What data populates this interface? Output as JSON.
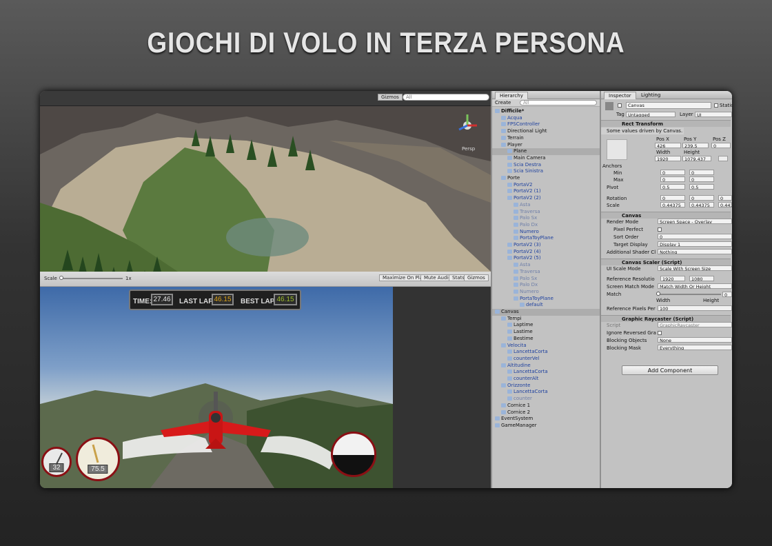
{
  "headline": "GIOCHI DI VOLO IN TERZA PERSONA",
  "scene_view": {
    "toolbar": {
      "gizmos_label": "Gizmos",
      "search_placeholder": "All"
    },
    "persp_label": "Persp"
  },
  "game_view": {
    "toolbar": {
      "scale_label": "Scale",
      "scale_value": "1x",
      "maximize_label": "Maximize On Play",
      "mute_label": "Mute Audio",
      "stats_label": "Stats",
      "gizmos_label": "Gizmos"
    },
    "hud": {
      "time_label": "TIME:",
      "time_value": "27.46",
      "last_lap_label": "LAST LAP:",
      "last_lap_value": "46.15",
      "best_lap_label": "BEST LAP:",
      "best_lap_value": "46.15"
    },
    "gauge_small_value": "32",
    "gauge_large_value": "75.5"
  },
  "hierarchy": {
    "tab_label": "Hierarchy",
    "create_label": "Create",
    "search_placeholder": "All",
    "items": [
      {
        "label": "Difficile*",
        "depth": 0,
        "style": "bold"
      },
      {
        "label": "Acqua",
        "depth": 1,
        "style": "blue"
      },
      {
        "label": "FPSController",
        "depth": 1,
        "style": "blue"
      },
      {
        "label": "Directional Light",
        "depth": 1,
        "style": "normal"
      },
      {
        "label": "Terrain",
        "depth": 1,
        "style": "normal"
      },
      {
        "label": "Player",
        "depth": 1,
        "style": "normal"
      },
      {
        "label": "Plane",
        "depth": 2,
        "style": "selected"
      },
      {
        "label": "Main Camera",
        "depth": 2,
        "style": "normal"
      },
      {
        "label": "Scia Destra",
        "depth": 2,
        "style": "blue"
      },
      {
        "label": "Scia Sinistra",
        "depth": 2,
        "style": "blue"
      },
      {
        "label": "Porte",
        "depth": 1,
        "style": "normal"
      },
      {
        "label": "PortaV2",
        "depth": 2,
        "style": "blue"
      },
      {
        "label": "PortaV2 (1)",
        "depth": 2,
        "style": "blue"
      },
      {
        "label": "PortaV2 (2)",
        "depth": 2,
        "style": "blue"
      },
      {
        "label": "Asta",
        "depth": 3,
        "style": "faded"
      },
      {
        "label": "Traversa",
        "depth": 3,
        "style": "faded"
      },
      {
        "label": "Palo Sx",
        "depth": 3,
        "style": "faded"
      },
      {
        "label": "Palo Dx",
        "depth": 3,
        "style": "faded"
      },
      {
        "label": "Numero",
        "depth": 3,
        "style": "blue"
      },
      {
        "label": "PortaToyPlane",
        "depth": 3,
        "style": "blue"
      },
      {
        "label": "PortaV2 (3)",
        "depth": 2,
        "style": "blue"
      },
      {
        "label": "PortaV2 (4)",
        "depth": 2,
        "style": "blue"
      },
      {
        "label": "PortaV2 (5)",
        "depth": 2,
        "style": "blue"
      },
      {
        "label": "Asta",
        "depth": 3,
        "style": "faded"
      },
      {
        "label": "Traversa",
        "depth": 3,
        "style": "faded"
      },
      {
        "label": "Palo Sx",
        "depth": 3,
        "style": "faded"
      },
      {
        "label": "Palo Dx",
        "depth": 3,
        "style": "faded"
      },
      {
        "label": "Numero",
        "depth": 3,
        "style": "faded"
      },
      {
        "label": "PortaToyPlane",
        "depth": 3,
        "style": "blue"
      },
      {
        "label": "default",
        "depth": 4,
        "style": "blue"
      },
      {
        "label": "Canvas",
        "depth": 0,
        "style": "selected"
      },
      {
        "label": "Tempi",
        "depth": 1,
        "style": "normal"
      },
      {
        "label": "Laptime",
        "depth": 2,
        "style": "normal"
      },
      {
        "label": "Lastime",
        "depth": 2,
        "style": "normal"
      },
      {
        "label": "Bestime",
        "depth": 2,
        "style": "normal"
      },
      {
        "label": "Velocita",
        "depth": 1,
        "style": "blue"
      },
      {
        "label": "LancettaCorta",
        "depth": 2,
        "style": "blue"
      },
      {
        "label": "counterVel",
        "depth": 2,
        "style": "blue"
      },
      {
        "label": "Altitudine",
        "depth": 1,
        "style": "blue"
      },
      {
        "label": "LancettaCorta",
        "depth": 2,
        "style": "blue"
      },
      {
        "label": "counterAlt",
        "depth": 2,
        "style": "blue"
      },
      {
        "label": "Orizzonte",
        "depth": 1,
        "style": "blue"
      },
      {
        "label": "LancettaCorta",
        "depth": 2,
        "style": "blue"
      },
      {
        "label": "counter",
        "depth": 2,
        "style": "faded"
      },
      {
        "label": "Cornice 1",
        "depth": 1,
        "style": "normal"
      },
      {
        "label": "Cornice 2",
        "depth": 1,
        "style": "normal"
      },
      {
        "label": "EventSystem",
        "depth": 0,
        "style": "normal"
      },
      {
        "label": "GameManager",
        "depth": 0,
        "style": "normal"
      }
    ]
  },
  "inspector": {
    "tab_label": "Inspector",
    "lighting_tab_label": "Lighting",
    "object_name": "Canvas",
    "static_label": "Static",
    "tag_label": "Tag",
    "tag_value": "Untagged",
    "layer_label": "Layer",
    "layer_value": "UI",
    "rect_transform": {
      "title": "Rect Transform",
      "note": "Some values driven by Canvas.",
      "pos_x_label": "Pos X",
      "pos_y_label": "Pos Y",
      "pos_z_label": "Pos Z",
      "pos_x": "426",
      "pos_y": "239.5",
      "pos_z": "0",
      "width_label": "Width",
      "height_label": "Height",
      "width": "1920",
      "height": "1079.437",
      "anchors_label": "Anchors",
      "min_label": "Min",
      "min_x": "0",
      "min_y": "0",
      "max_label": "Max",
      "max_x": "0",
      "max_y": "0",
      "pivot_label": "Pivot",
      "pivot_x": "0.5",
      "pivot_y": "0.5",
      "rotation_label": "Rotation",
      "rot_x": "0",
      "rot_y": "0",
      "rot_z": "0",
      "scale_label": "Scale",
      "scale_x": "0.44375",
      "scale_y": "0.44375",
      "scale_z": "0.44375"
    },
    "canvas": {
      "title": "Canvas",
      "render_mode_label": "Render Mode",
      "render_mode_value": "Screen Space - Overlay",
      "pixel_perfect_label": "Pixel Perfect",
      "sort_order_label": "Sort Order",
      "sort_order_value": "0",
      "target_display_label": "Target Display",
      "target_display_value": "Display 1",
      "shader_label": "Additional Shader Cl",
      "shader_value": "Nothing"
    },
    "scaler": {
      "title": "Canvas Scaler (Script)",
      "ui_scale_label": "UI Scale Mode",
      "ui_scale_value": "Scale With Screen Size",
      "ref_res_label": "Reference Resolutio",
      "ref_x": "1920",
      "ref_y": "1080",
      "match_mode_label": "Screen Match Mode",
      "match_mode_value": "Match Width Or Height",
      "match_label": "Match",
      "match_value": "0",
      "width_tick": "Width",
      "height_tick": "Height",
      "ref_ppu_label": "Reference Pixels Per",
      "ref_ppu_value": "100"
    },
    "raycaster": {
      "title": "Graphic Raycaster (Script)",
      "script_label": "Script",
      "script_value": "GraphicRaycaster",
      "ignore_label": "Ignore Reversed Gra",
      "blocking_objects_label": "Blocking Objects",
      "blocking_objects_value": "None",
      "blocking_mask_label": "Blocking Mask",
      "blocking_mask_value": "Everything"
    },
    "add_component_label": "Add Component"
  }
}
